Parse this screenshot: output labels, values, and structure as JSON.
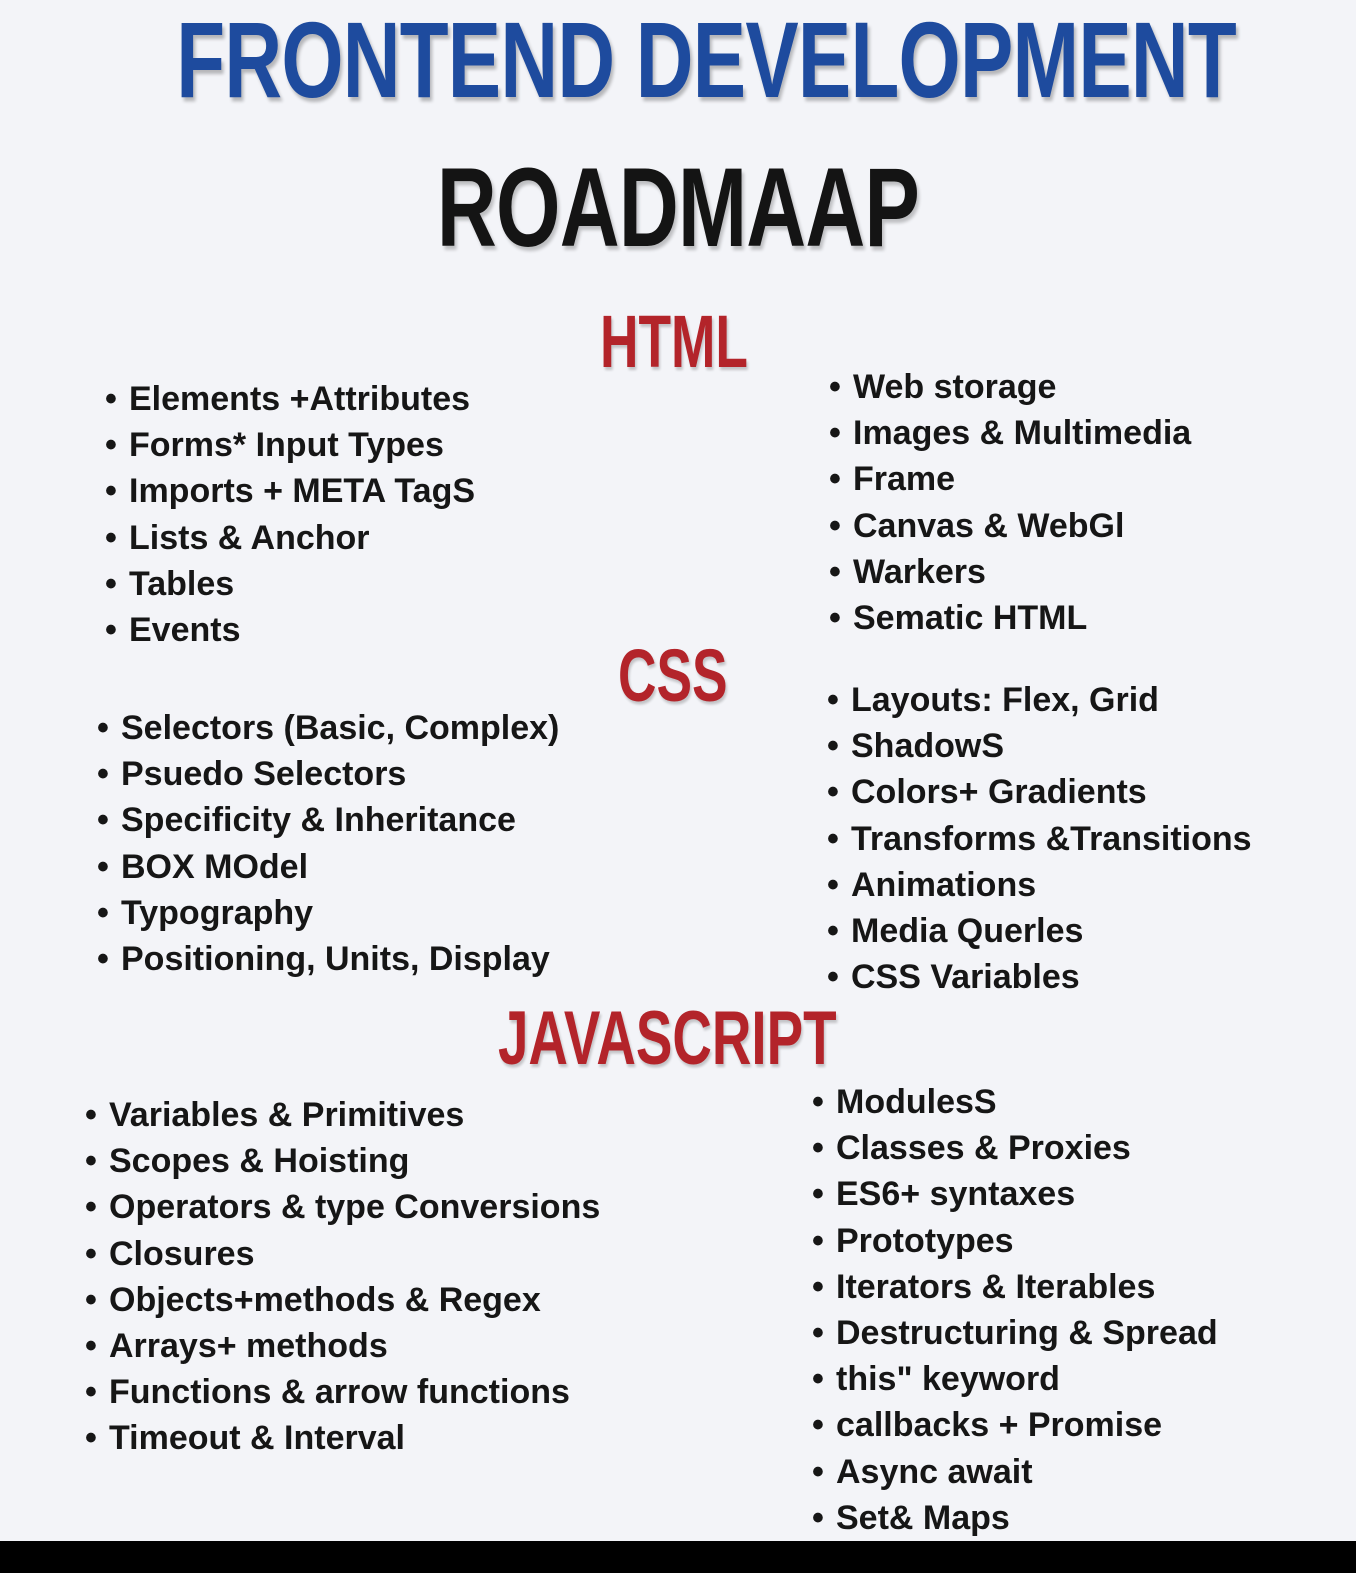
{
  "header": {
    "title": "FRONTEND DEVELOPMENT",
    "subtitle": "ROADMAAP"
  },
  "sections": {
    "html": {
      "heading": "HTML",
      "left": [
        "Elements +Attributes",
        "Forms* Input Types",
        "Imports + META TagS",
        "Lists & Anchor",
        "Tables",
        "Events"
      ],
      "right": [
        "Web storage",
        "Images & Multimedia",
        "Frame",
        "Canvas & WebGl",
        "Warkers",
        "Sematic HTML"
      ]
    },
    "css": {
      "heading": "CSS",
      "left": [
        "Selectors (Basic, Complex)",
        "Psuedo Selectors",
        "Specificity & Inheritance",
        "BOX MOdel",
        "Typography",
        "Positioning, Units, Display"
      ],
      "right": [
        "Layouts: Flex, Grid",
        "ShadowS",
        "Colors+ Gradients",
        "Transforms &Transitions",
        "Animations",
        "Media Querles",
        "CSS Variables"
      ]
    },
    "javascript": {
      "heading": "JAVASCRIPT",
      "left": [
        "Variables & Primitives",
        "Scopes & Hoisting",
        "Operators & type Conversions",
        "Closures",
        "Objects+methods & Regex",
        "Arrays+ methods",
        "Functions & arrow functions",
        "Timeout & Interval"
      ],
      "right": [
        "ModulesS",
        "Classes & Proxies",
        "ES6+ syntaxes",
        "Prototypes",
        "Iterators & Iterables",
        "Destructuring & Spread",
        "this\" keyword",
        "callbacks + Promise",
        "Async await",
        "Set& Maps"
      ]
    }
  },
  "colors": {
    "title": "#1e4b9e",
    "subtitle": "#141414",
    "section_heading": "#b3242a",
    "text": "#161616",
    "background": "#f3f4f8"
  }
}
